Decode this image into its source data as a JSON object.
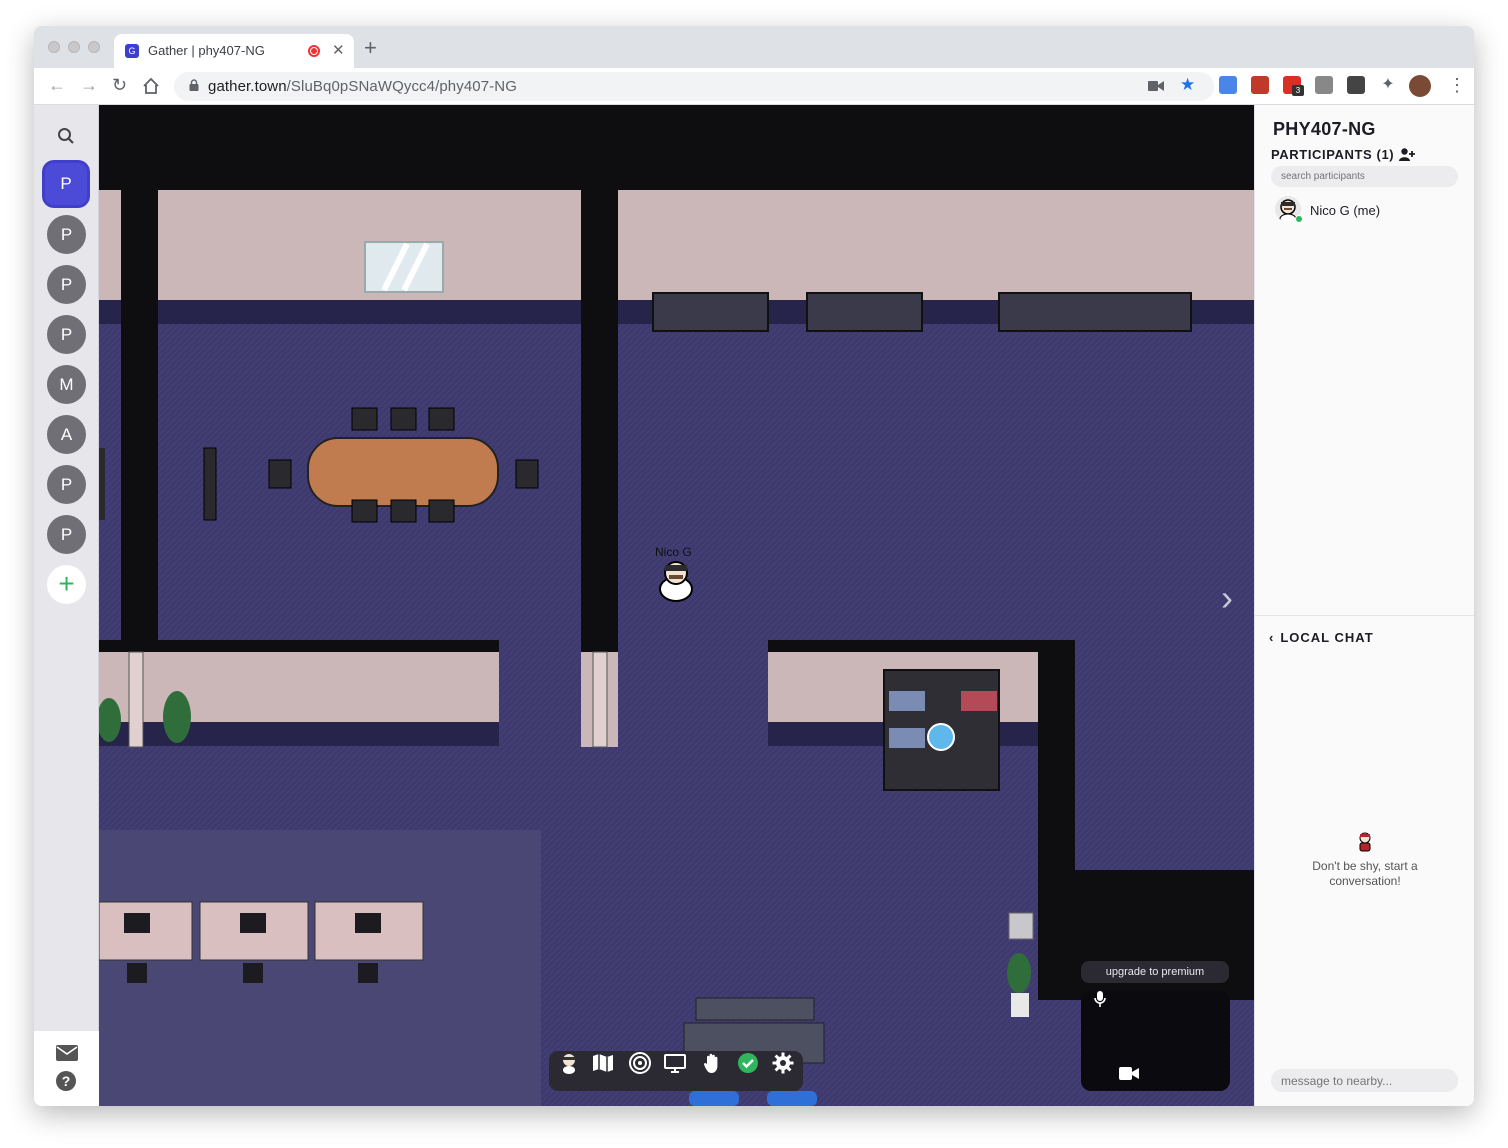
{
  "browser": {
    "tab_title": "Gather | phy407-NG",
    "tab_favicon_glyph": "G",
    "new_tab_icon": "plus-icon",
    "url_host": "gather.town",
    "url_path": "/SluBq0pSNaWQycc4/phy407-NG",
    "extension_badge": "3"
  },
  "sidebar": {
    "search_icon": "search-icon",
    "spaces": [
      {
        "letter": "P",
        "active": true
      },
      {
        "letter": "P",
        "active": false
      },
      {
        "letter": "P",
        "active": false
      },
      {
        "letter": "P",
        "active": false
      },
      {
        "letter": "M",
        "active": false
      },
      {
        "letter": "A",
        "active": false
      },
      {
        "letter": "P",
        "active": false
      },
      {
        "letter": "P",
        "active": false
      }
    ],
    "add_label": "+",
    "mail_icon": "mail-icon",
    "help_icon": "help-icon"
  },
  "map": {
    "avatar_name": "Nico G",
    "next_icon": "›",
    "toolbar_icons": [
      "avatar-icon",
      "map-icon",
      "target-icon",
      "screen-share-icon",
      "raise-hand-icon",
      "status-check-icon",
      "settings-icon"
    ],
    "premium_label": "upgrade to premium"
  },
  "panel": {
    "space_title": "PHY407-NG",
    "participants_heading": "PARTICIPANTS (1)",
    "search_placeholder": "search participants",
    "participants": [
      {
        "name": "Nico G (me)",
        "status": "online"
      }
    ],
    "chat_heading": "LOCAL CHAT",
    "chat_empty_text": "Don't be shy, start a conversation!",
    "chat_placeholder": "message to nearby..."
  },
  "colors": {
    "accent": "#4b4bd8",
    "online": "#2fb65d",
    "carpet": "#3e3a6e",
    "wall": "#cbb7b8"
  }
}
